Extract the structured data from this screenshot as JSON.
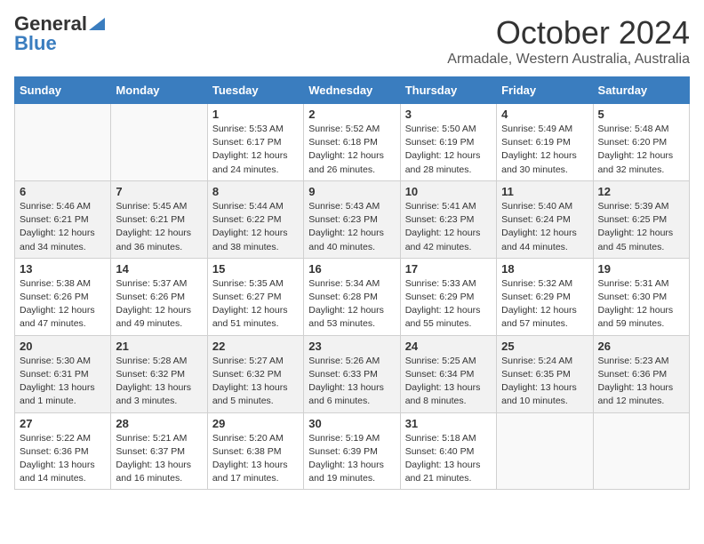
{
  "header": {
    "logo_general": "General",
    "logo_blue": "Blue",
    "month_title": "October 2024",
    "location": "Armadale, Western Australia, Australia"
  },
  "days_of_week": [
    "Sunday",
    "Monday",
    "Tuesday",
    "Wednesday",
    "Thursday",
    "Friday",
    "Saturday"
  ],
  "weeks": [
    [
      {
        "day": "",
        "info": ""
      },
      {
        "day": "",
        "info": ""
      },
      {
        "day": "1",
        "info": "Sunrise: 5:53 AM\nSunset: 6:17 PM\nDaylight: 12 hours and 24 minutes."
      },
      {
        "day": "2",
        "info": "Sunrise: 5:52 AM\nSunset: 6:18 PM\nDaylight: 12 hours and 26 minutes."
      },
      {
        "day": "3",
        "info": "Sunrise: 5:50 AM\nSunset: 6:19 PM\nDaylight: 12 hours and 28 minutes."
      },
      {
        "day": "4",
        "info": "Sunrise: 5:49 AM\nSunset: 6:19 PM\nDaylight: 12 hours and 30 minutes."
      },
      {
        "day": "5",
        "info": "Sunrise: 5:48 AM\nSunset: 6:20 PM\nDaylight: 12 hours and 32 minutes."
      }
    ],
    [
      {
        "day": "6",
        "info": "Sunrise: 5:46 AM\nSunset: 6:21 PM\nDaylight: 12 hours and 34 minutes."
      },
      {
        "day": "7",
        "info": "Sunrise: 5:45 AM\nSunset: 6:21 PM\nDaylight: 12 hours and 36 minutes."
      },
      {
        "day": "8",
        "info": "Sunrise: 5:44 AM\nSunset: 6:22 PM\nDaylight: 12 hours and 38 minutes."
      },
      {
        "day": "9",
        "info": "Sunrise: 5:43 AM\nSunset: 6:23 PM\nDaylight: 12 hours and 40 minutes."
      },
      {
        "day": "10",
        "info": "Sunrise: 5:41 AM\nSunset: 6:23 PM\nDaylight: 12 hours and 42 minutes."
      },
      {
        "day": "11",
        "info": "Sunrise: 5:40 AM\nSunset: 6:24 PM\nDaylight: 12 hours and 44 minutes."
      },
      {
        "day": "12",
        "info": "Sunrise: 5:39 AM\nSunset: 6:25 PM\nDaylight: 12 hours and 45 minutes."
      }
    ],
    [
      {
        "day": "13",
        "info": "Sunrise: 5:38 AM\nSunset: 6:26 PM\nDaylight: 12 hours and 47 minutes."
      },
      {
        "day": "14",
        "info": "Sunrise: 5:37 AM\nSunset: 6:26 PM\nDaylight: 12 hours and 49 minutes."
      },
      {
        "day": "15",
        "info": "Sunrise: 5:35 AM\nSunset: 6:27 PM\nDaylight: 12 hours and 51 minutes."
      },
      {
        "day": "16",
        "info": "Sunrise: 5:34 AM\nSunset: 6:28 PM\nDaylight: 12 hours and 53 minutes."
      },
      {
        "day": "17",
        "info": "Sunrise: 5:33 AM\nSunset: 6:29 PM\nDaylight: 12 hours and 55 minutes."
      },
      {
        "day": "18",
        "info": "Sunrise: 5:32 AM\nSunset: 6:29 PM\nDaylight: 12 hours and 57 minutes."
      },
      {
        "day": "19",
        "info": "Sunrise: 5:31 AM\nSunset: 6:30 PM\nDaylight: 12 hours and 59 minutes."
      }
    ],
    [
      {
        "day": "20",
        "info": "Sunrise: 5:30 AM\nSunset: 6:31 PM\nDaylight: 13 hours and 1 minute."
      },
      {
        "day": "21",
        "info": "Sunrise: 5:28 AM\nSunset: 6:32 PM\nDaylight: 13 hours and 3 minutes."
      },
      {
        "day": "22",
        "info": "Sunrise: 5:27 AM\nSunset: 6:32 PM\nDaylight: 13 hours and 5 minutes."
      },
      {
        "day": "23",
        "info": "Sunrise: 5:26 AM\nSunset: 6:33 PM\nDaylight: 13 hours and 6 minutes."
      },
      {
        "day": "24",
        "info": "Sunrise: 5:25 AM\nSunset: 6:34 PM\nDaylight: 13 hours and 8 minutes."
      },
      {
        "day": "25",
        "info": "Sunrise: 5:24 AM\nSunset: 6:35 PM\nDaylight: 13 hours and 10 minutes."
      },
      {
        "day": "26",
        "info": "Sunrise: 5:23 AM\nSunset: 6:36 PM\nDaylight: 13 hours and 12 minutes."
      }
    ],
    [
      {
        "day": "27",
        "info": "Sunrise: 5:22 AM\nSunset: 6:36 PM\nDaylight: 13 hours and 14 minutes."
      },
      {
        "day": "28",
        "info": "Sunrise: 5:21 AM\nSunset: 6:37 PM\nDaylight: 13 hours and 16 minutes."
      },
      {
        "day": "29",
        "info": "Sunrise: 5:20 AM\nSunset: 6:38 PM\nDaylight: 13 hours and 17 minutes."
      },
      {
        "day": "30",
        "info": "Sunrise: 5:19 AM\nSunset: 6:39 PM\nDaylight: 13 hours and 19 minutes."
      },
      {
        "day": "31",
        "info": "Sunrise: 5:18 AM\nSunset: 6:40 PM\nDaylight: 13 hours and 21 minutes."
      },
      {
        "day": "",
        "info": ""
      },
      {
        "day": "",
        "info": ""
      }
    ]
  ]
}
